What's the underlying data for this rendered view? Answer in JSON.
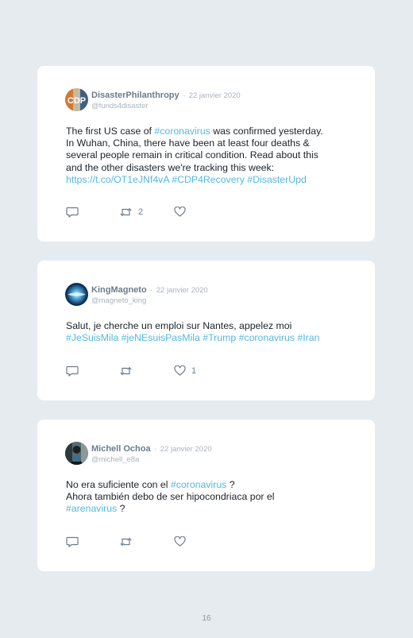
{
  "tweets": [
    {
      "author": "DisasterPhilanthropy",
      "date": "22 janvier 2020",
      "handle": "@funds4disaster",
      "avatar_text": "CDP",
      "body_lines": [
        [
          {
            "t": "The first US case of "
          },
          {
            "t": "#coronavirus",
            "tag": true
          },
          {
            "t": " was confirmed yesterday."
          }
        ],
        [
          {
            "t": "In Wuhan, China, there have been at least four deaths &"
          }
        ],
        [
          {
            "t": "several people remain in critical condition. Read about this"
          }
        ],
        [
          {
            "t": "and the other disasters we're tracking this week:"
          }
        ],
        [
          {
            "t": "https://t.co/OT1eJNf4vA",
            "tag": true
          },
          {
            "t": " "
          },
          {
            "t": "#CDP4Recovery",
            "tag": true
          },
          {
            "t": " "
          },
          {
            "t": "#DisasterUpd",
            "tag": true
          }
        ]
      ],
      "reply_count": "",
      "retweet_count": "2",
      "like_count": ""
    },
    {
      "author": "KingMagneto",
      "date": "22 janvier 2020",
      "handle": "@magneto_king",
      "body_lines": [
        [
          {
            "t": "Salut, je cherche un emploi sur Nantes, appelez moi"
          }
        ],
        [
          {
            "t": "#JeSuisMila",
            "tag": true
          },
          {
            "t": " "
          },
          {
            "t": "#jeNEsuisPasMila",
            "tag": true
          },
          {
            "t": " "
          },
          {
            "t": "#Trump",
            "tag": true
          },
          {
            "t": " "
          },
          {
            "t": "#coronavirus",
            "tag": true
          },
          {
            "t": " "
          },
          {
            "t": "#Iran",
            "tag": true
          }
        ]
      ],
      "reply_count": "",
      "retweet_count": "",
      "like_count": "1"
    },
    {
      "author": "Michell Ochoa",
      "date": "22 janvier 2020",
      "handle": "@michell_e8a",
      "body_lines": [
        [
          {
            "t": "No era suficiente con el "
          },
          {
            "t": "#coronavirus",
            "tag": true
          },
          {
            "t": " ?"
          }
        ],
        [
          {
            "t": "Ahora también debo de ser hipocondriaca por el"
          }
        ],
        [
          {
            "t": "#arenavirus",
            "tag": true
          },
          {
            "t": " ?"
          }
        ]
      ],
      "reply_count": "",
      "retweet_count": "",
      "like_count": ""
    }
  ],
  "separator": "·",
  "page_number": "16",
  "colors": {
    "background": "#e6ebef",
    "card": "#ffffff",
    "hashtag": "#55b8e0",
    "name": "#6b7c8c",
    "muted": "#a9b4bd"
  },
  "icons": [
    "reply-icon",
    "retweet-icon",
    "like-icon"
  ]
}
